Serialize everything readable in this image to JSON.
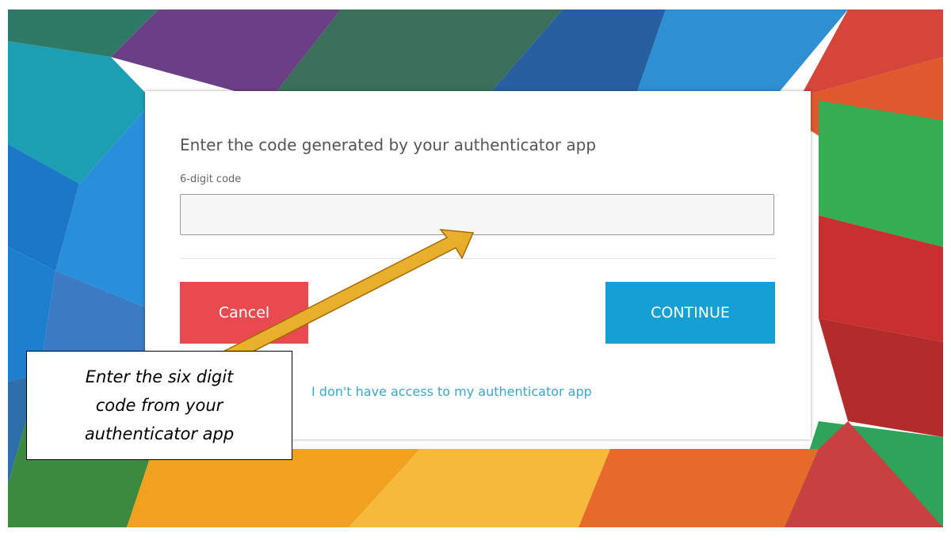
{
  "dialog": {
    "title": "Enter the code generated by your authenticator app",
    "code_label": "6-digit code",
    "code_value": "",
    "cancel_label": "Cancel",
    "continue_label": "CONTINUE",
    "no_access_link": "I don't have access to my authenticator app"
  },
  "annotation": {
    "line1": "Enter the six digit",
    "line2": "code from your",
    "line3": "authenticator app"
  },
  "colors": {
    "cancel_button": "#e84a4f",
    "continue_button": "#159fd2",
    "link": "#3da6cc",
    "arrow": "#f0b020"
  }
}
